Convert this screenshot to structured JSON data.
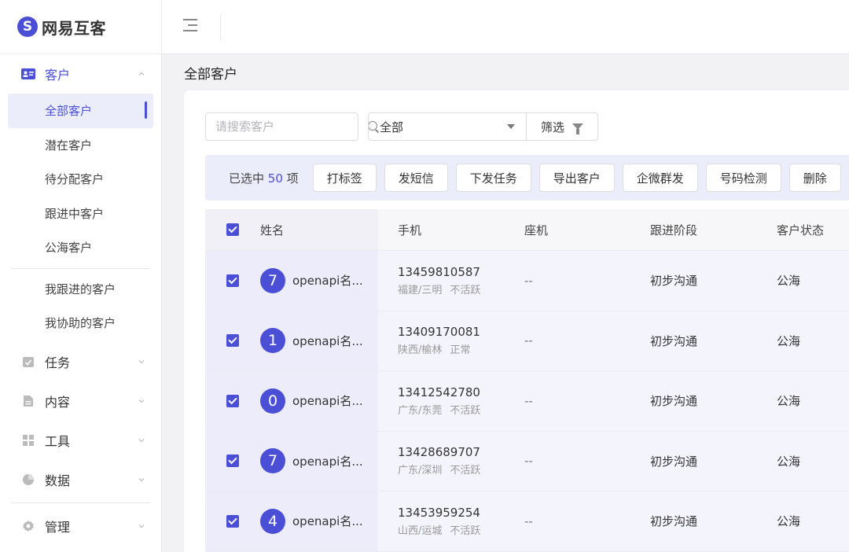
{
  "brand": {
    "name": "网易互客",
    "logo_letter": "S"
  },
  "sidebar": {
    "customer_group": {
      "label": "客户",
      "icon": "contact-card-icon"
    },
    "customer_items": [
      "全部客户",
      "潜在客户",
      "待分配客户",
      "跟进中客户",
      "公海客户"
    ],
    "customer_items2": [
      "我跟进的客户",
      "我协助的客户"
    ],
    "groups": [
      {
        "label": "任务",
        "icon": "task-icon"
      },
      {
        "label": "内容",
        "icon": "document-icon"
      },
      {
        "label": "工具",
        "icon": "grid-icon"
      },
      {
        "label": "数据",
        "icon": "pie-chart-icon"
      },
      {
        "label": "管理",
        "icon": "gear-icon"
      }
    ]
  },
  "page": {
    "title": "全部客户"
  },
  "filters": {
    "search_placeholder": "请搜索客户",
    "select_value": "全部",
    "filter_label": "筛选"
  },
  "actions": {
    "selected_prefix": "已选中",
    "selected_count": "50",
    "selected_suffix": "项",
    "buttons": [
      "打标签",
      "发短信",
      "下发任务",
      "导出客户",
      "企微群发",
      "号码检测",
      "删除"
    ]
  },
  "table": {
    "headers": {
      "name": "姓名",
      "phone": "手机",
      "seat": "座机",
      "stage": "跟进阶段",
      "status": "客户状态"
    },
    "rows": [
      {
        "avatar": "7",
        "name": "openapi名...",
        "phone": "13459810587",
        "region": "福建/三明",
        "activity": "不活跃",
        "seat": "--",
        "stage": "初步沟通",
        "status": "公海"
      },
      {
        "avatar": "1",
        "name": "openapi名...",
        "phone": "13409170081",
        "region": "陕西/榆林",
        "activity": "正常",
        "seat": "--",
        "stage": "初步沟通",
        "status": "公海"
      },
      {
        "avatar": "0",
        "name": "openapi名...",
        "phone": "13412542780",
        "region": "广东/东莞",
        "activity": "不活跃",
        "seat": "--",
        "stage": "初步沟通",
        "status": "公海"
      },
      {
        "avatar": "7",
        "name": "openapi名...",
        "phone": "13428689707",
        "region": "广东/深圳",
        "activity": "不活跃",
        "seat": "--",
        "stage": "初步沟通",
        "status": "公海"
      },
      {
        "avatar": "4",
        "name": "openapi名...",
        "phone": "13453959254",
        "region": "山西/运城",
        "activity": "不活跃",
        "seat": "--",
        "stage": "初步沟通",
        "status": "公海"
      }
    ]
  },
  "colors": {
    "accent": "#4b4fd6",
    "selected_bg": "#ecedfb"
  }
}
